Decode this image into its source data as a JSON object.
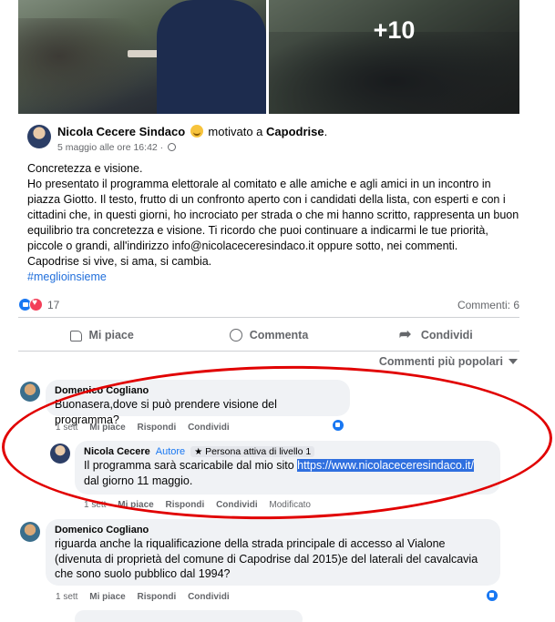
{
  "photos": {
    "more_count": "+10"
  },
  "post": {
    "author": "Nicola Cecere Sindaco",
    "feeling": "motivato a",
    "place": "Capodrise",
    "place_suffix": ".",
    "timestamp": "5 maggio alle ore 16:42",
    "separator": " · ",
    "paragraphs": [
      "Concretezza e visione.",
      "Ho presentato il programma elettorale al comitato e alle amiche e agli amici in un incontro in piazza Giotto. Il testo, frutto di un confronto aperto con i candidati della lista, con esperti e con i cittadini che, in questi giorni, ho incrociato per strada o che mi hanno scritto, rappresenta un buon equilibrio tra concretezza e visione. Ti ricordo che puoi continuare a indicarmi le tue priorità, piccole o grandi, all'indirizzo info@nicolaceceresindaco.it oppure sotto, nei commenti.",
      "Capodrise si vive, si ama, si cambia."
    ],
    "hashtag": "#meglioinsieme",
    "reaction_count": "17",
    "comments_count": "Commenti: 6"
  },
  "actions": {
    "like": "Mi piace",
    "comment": "Commenta",
    "share": "Condividi"
  },
  "sort": {
    "label": "Commenti più popolari"
  },
  "comments": [
    {
      "author": "Domenico Cogliano",
      "text": "Buonasera,dove si può prendere visione del programma?",
      "time": "1 sett",
      "like": "Mi piace",
      "reply": "Rispondi",
      "share": "Condividi"
    },
    {
      "author": "Nicola Cecere",
      "author_badge": "Autore",
      "level_badge": "Persona attiva di livello 1",
      "text_before": "Il programma sarà scaricabile dal mio sito ",
      "link": "https://www.nicolaceceresindaco.it/",
      "text_after": " dal giorno 11 maggio.",
      "time": "1 sett",
      "like": "Mi piace",
      "reply": "Rispondi",
      "share": "Condividi",
      "edited": "Modificato"
    },
    {
      "author": "Domenico Cogliano",
      "text": "riguarda anche la riqualificazione della strada principale di accesso al Vialone (divenuta di proprietà del comune di Capodrise dal 2015)e del laterali del cavalcavia che sono suolo pubblico dal 1994?",
      "time": "1 sett",
      "like": "Mi piace",
      "reply": "Rispondi",
      "share": "Condividi"
    }
  ],
  "colors": {
    "link": "#216fdb",
    "author_badge": "#1877f2",
    "annotation": "#e10000",
    "link_highlight": "#2f6fdf"
  }
}
